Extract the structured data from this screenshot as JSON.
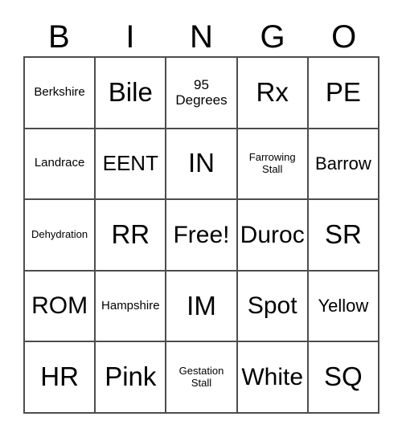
{
  "card": {
    "type": "bingo-card",
    "columns": 5,
    "rows": 5,
    "header": {
      "letters": [
        "B",
        "I",
        "N",
        "G",
        "O"
      ]
    },
    "colors": {
      "text": "#000000",
      "grid_line": "#4d4d4d",
      "background": "#ffffff"
    },
    "grid": [
      [
        {
          "text": "Berkshire",
          "size": "xs",
          "free": false
        },
        {
          "text": "Bile",
          "size": "xxl",
          "free": false
        },
        {
          "text": "95 Degrees",
          "size": "sm",
          "free": false
        },
        {
          "text": "Rx",
          "size": "xxl",
          "free": false
        },
        {
          "text": "PE",
          "size": "xxl",
          "free": false
        }
      ],
      [
        {
          "text": "Landrace",
          "size": "xs",
          "free": false
        },
        {
          "text": "EENT",
          "size": "lg",
          "free": false
        },
        {
          "text": "IN",
          "size": "xxl",
          "free": false
        },
        {
          "text": "Farrowing Stall",
          "size": "xxs",
          "free": false
        },
        {
          "text": "Barrow",
          "size": "md",
          "free": false
        }
      ],
      [
        {
          "text": "Dehydration",
          "size": "xxs",
          "free": false
        },
        {
          "text": "RR",
          "size": "xxl",
          "free": false
        },
        {
          "text": "Free!",
          "size": "xl",
          "free": true
        },
        {
          "text": "Duroc",
          "size": "xl",
          "free": false
        },
        {
          "text": "SR",
          "size": "xxl",
          "free": false
        }
      ],
      [
        {
          "text": "ROM",
          "size": "xl",
          "free": false
        },
        {
          "text": "Hampshire",
          "size": "xs",
          "free": false
        },
        {
          "text": "IM",
          "size": "xxl",
          "free": false
        },
        {
          "text": "Spot",
          "size": "xl",
          "free": false
        },
        {
          "text": "Yellow",
          "size": "md",
          "free": false
        }
      ],
      [
        {
          "text": "HR",
          "size": "xxl",
          "free": false
        },
        {
          "text": "Pink",
          "size": "xxl",
          "free": false
        },
        {
          "text": "Gestation Stall",
          "size": "xxs",
          "free": false
        },
        {
          "text": "White",
          "size": "xl",
          "free": false
        },
        {
          "text": "SQ",
          "size": "xxl",
          "free": false
        }
      ]
    ]
  }
}
